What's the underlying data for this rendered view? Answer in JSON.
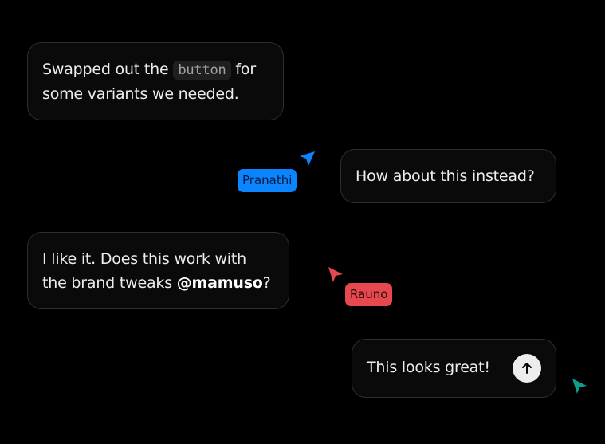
{
  "messages": [
    {
      "before": "Swapped out the ",
      "code": "button",
      "after": " for some variants we needed."
    },
    {
      "text": "How about this instead?"
    },
    {
      "before": "I like it. Does this work with the brand tweaks ",
      "mention": "@mamuso",
      "after": "?"
    },
    {
      "text": "This looks great!"
    }
  ],
  "cursors": [
    {
      "name": "Pranathi",
      "color": "#0a84ff"
    },
    {
      "name": "Rauno",
      "color": "#e5484d"
    },
    {
      "name": "",
      "color": "#0e9f8a"
    }
  ],
  "send_button": {
    "icon": "arrow-up-icon"
  }
}
